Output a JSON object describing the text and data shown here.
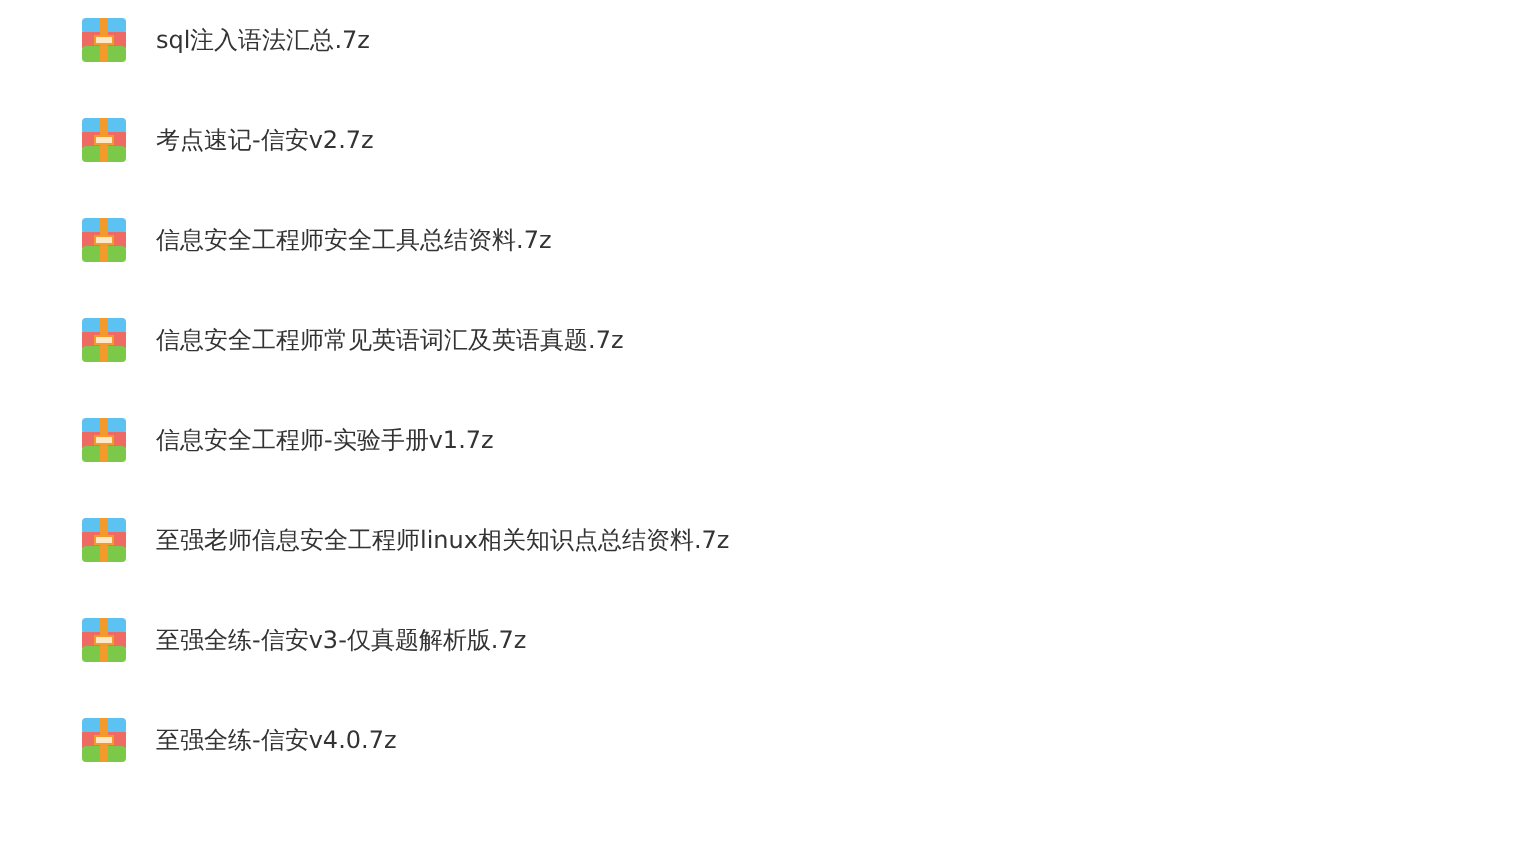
{
  "files": [
    {
      "name": "sql注入语法汇总.7z"
    },
    {
      "name": "考点速记-信安v2.7z"
    },
    {
      "name": "信息安全工程师安全工具总结资料.7z"
    },
    {
      "name": "信息安全工程师常见英语词汇及英语真题.7z"
    },
    {
      "name": "信息安全工程师-实验手册v1.7z"
    },
    {
      "name": "至强老师信息安全工程师linux相关知识点总结资料.7z"
    },
    {
      "name": "至强全练-信安v3-仅真题解析版.7z"
    },
    {
      "name": "至强全练-信安v4.0.7z"
    }
  ]
}
